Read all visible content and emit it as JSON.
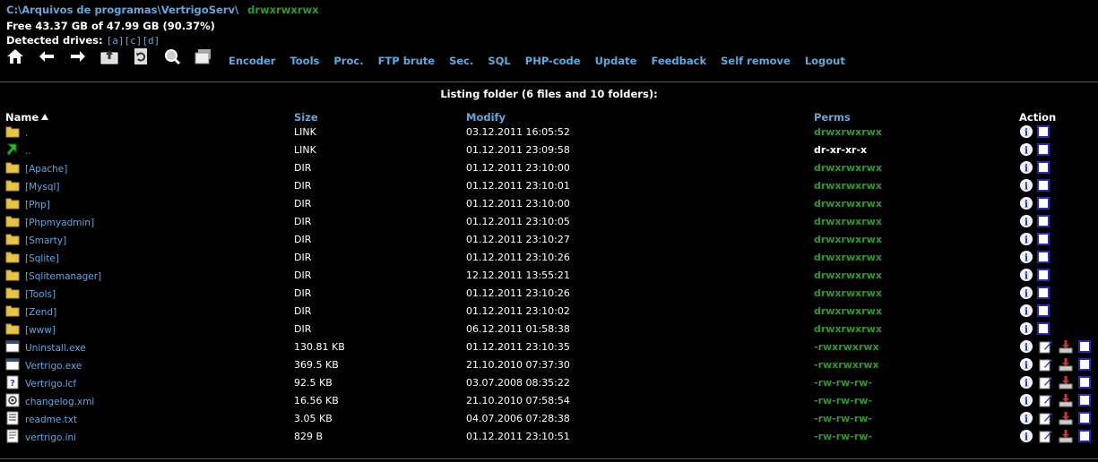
{
  "header": {
    "path": "C:\\Arquivos de programas\\VertrigoServ\\",
    "path_perms": "drwxrwxrwx",
    "free": "Free 43.37 GB of 47.99 GB (90.37%)",
    "drives_label": "Detected drives:",
    "drives": [
      "[a]",
      "[c]",
      "[d]"
    ]
  },
  "toolbar_icons": [
    "home-icon",
    "back-arrow-icon",
    "forward-arrow-icon",
    "parent-folder-icon",
    "refresh-icon",
    "search-icon",
    "folder-stack-icon"
  ],
  "menu": [
    "Encoder",
    "Tools",
    "Proc.",
    "FTP brute",
    "Sec.",
    "SQL",
    "PHP-code",
    "Update",
    "Feedback",
    "Self remove",
    "Logout"
  ],
  "listing": {
    "title": "Listing folder (6 files and 10 folders):",
    "columns": {
      "name": "Name",
      "size": "Size",
      "modify": "Modify",
      "perms": "Perms",
      "action": "Action"
    },
    "rows": [
      {
        "icon": "folder",
        "name": ".",
        "size": "LINK",
        "modify": "03.12.2011 16:05:52",
        "perms": "drwxrwxrwx",
        "perm_color": "green",
        "type": "dir"
      },
      {
        "icon": "up",
        "name": "..",
        "size": "LINK",
        "modify": "01.12.2011 23:09:58",
        "perms": "dr-xr-xr-x",
        "perm_color": "white",
        "type": "dir"
      },
      {
        "icon": "folder",
        "name": "[Apache]",
        "size": "DIR",
        "modify": "01.12.2011 23:10:00",
        "perms": "drwxrwxrwx",
        "perm_color": "green",
        "type": "dir"
      },
      {
        "icon": "folder",
        "name": "[Mysql]",
        "size": "DIR",
        "modify": "01.12.2011 23:10:01",
        "perms": "drwxrwxrwx",
        "perm_color": "green",
        "type": "dir"
      },
      {
        "icon": "folder",
        "name": "[Php]",
        "size": "DIR",
        "modify": "01.12.2011 23:10:00",
        "perms": "drwxrwxrwx",
        "perm_color": "green",
        "type": "dir"
      },
      {
        "icon": "folder",
        "name": "[Phpmyadmin]",
        "size": "DIR",
        "modify": "01.12.2011 23:10:05",
        "perms": "drwxrwxrwx",
        "perm_color": "green",
        "type": "dir"
      },
      {
        "icon": "folder",
        "name": "[Smarty]",
        "size": "DIR",
        "modify": "01.12.2011 23:10:27",
        "perms": "drwxrwxrwx",
        "perm_color": "green",
        "type": "dir"
      },
      {
        "icon": "folder",
        "name": "[Sqlite]",
        "size": "DIR",
        "modify": "01.12.2011 23:10:26",
        "perms": "drwxrwxrwx",
        "perm_color": "green",
        "type": "dir"
      },
      {
        "icon": "folder",
        "name": "[Sqlitemanager]",
        "size": "DIR",
        "modify": "12.12.2011 13:55:21",
        "perms": "drwxrwxrwx",
        "perm_color": "green",
        "type": "dir"
      },
      {
        "icon": "folder",
        "name": "[Tools]",
        "size": "DIR",
        "modify": "01.12.2011 23:10:26",
        "perms": "drwxrwxrwx",
        "perm_color": "green",
        "type": "dir"
      },
      {
        "icon": "folder",
        "name": "[Zend]",
        "size": "DIR",
        "modify": "01.12.2011 23:10:02",
        "perms": "drwxrwxrwx",
        "perm_color": "green",
        "type": "dir"
      },
      {
        "icon": "folder",
        "name": "[www]",
        "size": "DIR",
        "modify": "06.12.2011 01:58:38",
        "perms": "drwxrwxrwx",
        "perm_color": "green",
        "type": "dir"
      },
      {
        "icon": "exe",
        "name": "Uninstall.exe",
        "size": "130.81 KB",
        "modify": "01.12.2011 23:10:35",
        "perms": "-rwxrwxrwx",
        "perm_color": "green",
        "type": "file"
      },
      {
        "icon": "exe",
        "name": "Vertrigo.exe",
        "size": "369.5 KB",
        "modify": "21.10.2010 07:37:30",
        "perms": "-rwxrwxrwx",
        "perm_color": "green",
        "type": "file"
      },
      {
        "icon": "help",
        "name": "Vertrigo.lcf",
        "size": "92.5 KB",
        "modify": "03.07.2008 08:35:22",
        "perms": "-rw-rw-rw-",
        "perm_color": "green",
        "type": "file"
      },
      {
        "icon": "xml",
        "name": "changelog.xml",
        "size": "16.56 KB",
        "modify": "21.10.2010 07:58:54",
        "perms": "-rw-rw-rw-",
        "perm_color": "green",
        "type": "file"
      },
      {
        "icon": "txt",
        "name": "readme.txt",
        "size": "3.05 KB",
        "modify": "04.07.2006 07:28:38",
        "perms": "-rw-rw-rw-",
        "perm_color": "green",
        "type": "file"
      },
      {
        "icon": "ini",
        "name": "vertrigo.ini",
        "size": "829 B",
        "modify": "01.12.2011 23:10:51",
        "perms": "-rw-rw-rw-",
        "perm_color": "green",
        "type": "file"
      }
    ]
  },
  "colors": {
    "link": "#5fa8e0",
    "perm_green": "#2e9a2e",
    "background": "#000000"
  }
}
